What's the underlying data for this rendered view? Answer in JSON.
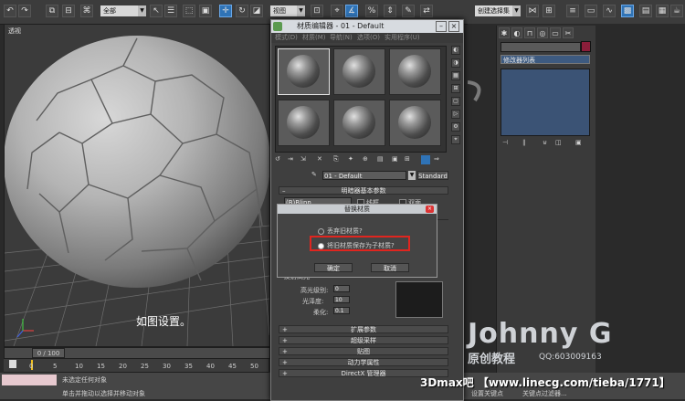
{
  "toolbar": {
    "selection_filter": "全部",
    "view_dropdown": "视图",
    "named_selection": "创建选择集"
  },
  "viewport": {
    "label": "透视",
    "caption": "如图设置。"
  },
  "command_panel": {
    "modifier_list": "修改器列表"
  },
  "material_editor": {
    "title": "材质编辑器 - 01 - Default",
    "menu": [
      "模式(D)",
      "材质(M)",
      "导航(N)",
      "选项(O)",
      "实用程序(U)"
    ],
    "material_name": "01 - Default",
    "material_type": "Standard",
    "basic_params_rollout": "明暗器基本参数",
    "shader": "(B)Blinn",
    "wire_label": "线框",
    "two_sided_label": "双面",
    "specular_rollout": "反射高光",
    "spec_level_label": "高光级别:",
    "spec_level_value": "0",
    "glossiness_label": "光泽度:",
    "glossiness_value": "10",
    "soften_label": "柔化:",
    "soften_value": "0.1",
    "rollouts": [
      "扩展参数",
      "超级采样",
      "贴图",
      "动力学属性",
      "DirectX 管理器"
    ]
  },
  "dialog": {
    "title": "替换材质",
    "option_discard": "丢弃旧材质?",
    "option_keep": "将旧材质保存为子材质?",
    "ok": "确定",
    "cancel": "取消"
  },
  "timeline": {
    "frame_counter": "0 / 100",
    "ticks": [
      "0",
      "5",
      "10",
      "15",
      "20",
      "25",
      "30",
      "35",
      "40",
      "45",
      "50"
    ]
  },
  "status": {
    "selected": "未选定任何对象",
    "prompt": "单击并拖动以选择并移动对象",
    "set_key": "设置关键点",
    "key_filter": "关键点过滤器..."
  },
  "branding": {
    "author": "Johnny G",
    "course": "原创教程",
    "qq": "QQ:603009163",
    "watermark": "3Dmax吧 【www.linecg.com/tieba/1771】"
  },
  "colors": {
    "accent": "#2f73b6",
    "highlight_box": "#e0251f",
    "modifier_stack": "#3b5375"
  }
}
